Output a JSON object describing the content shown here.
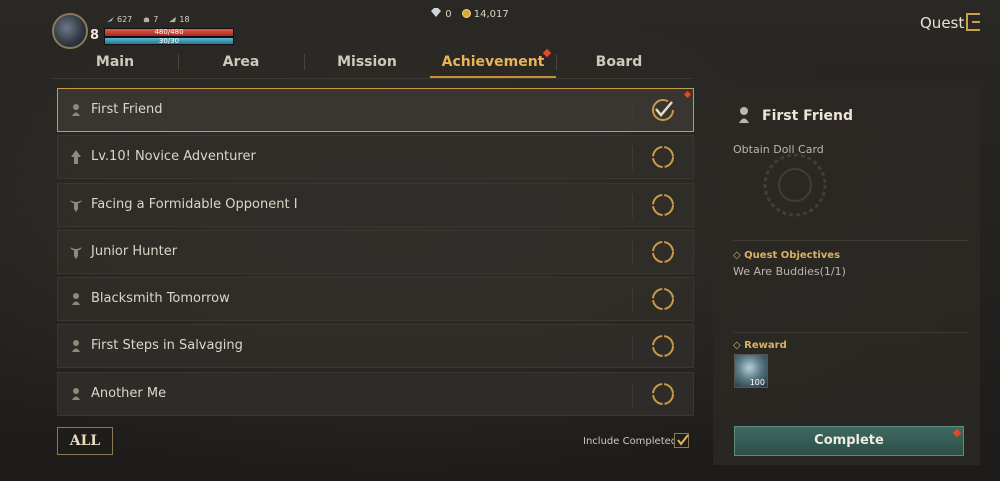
{
  "player": {
    "level": "8",
    "stat1": "627",
    "stat2": "7",
    "stat3": "18",
    "hp_text": "480/480",
    "mp_text": "30/30",
    "hp_fraction": 1.0,
    "mp_fraction": 1.0
  },
  "currency": {
    "gems": "0",
    "gold": "14,017"
  },
  "header": {
    "title": "Quest"
  },
  "tabs": [
    {
      "label": "Main"
    },
    {
      "label": "Area"
    },
    {
      "label": "Mission"
    },
    {
      "label": "Achievement",
      "active": true,
      "notify": true
    },
    {
      "label": "Board"
    }
  ],
  "achievements": [
    {
      "label": "First Friend",
      "icon": "doll-icon",
      "status": "completed",
      "selected": true
    },
    {
      "label": "Lv.10! Novice Adventurer",
      "icon": "arrow-up-icon",
      "status": "in-progress"
    },
    {
      "label": "Facing a Formidable Opponent I",
      "icon": "bull-skull-icon",
      "status": "in-progress"
    },
    {
      "label": "Junior Hunter",
      "icon": "bull-skull-icon",
      "status": "in-progress"
    },
    {
      "label": "Blacksmith Tomorrow",
      "icon": "doll-icon",
      "status": "in-progress"
    },
    {
      "label": "First Steps in Salvaging",
      "icon": "doll-icon",
      "status": "in-progress"
    },
    {
      "label": "Another Me",
      "icon": "doll-icon",
      "status": "in-progress"
    }
  ],
  "filter": {
    "all_label": "ALL",
    "include_completed_label": "Include Completed",
    "include_completed": true
  },
  "detail": {
    "title": "First Friend",
    "description": "Obtain Doll Card",
    "objectives_title": "Quest Objectives",
    "objective_text": "We Are Buddies(1/1)",
    "reward_title": "Reward",
    "reward_qty": "100",
    "complete_label": "Complete"
  },
  "colors": {
    "accent": "#e8b35a",
    "notify": "#e04a2a",
    "complete_button": "#3f6a62"
  }
}
